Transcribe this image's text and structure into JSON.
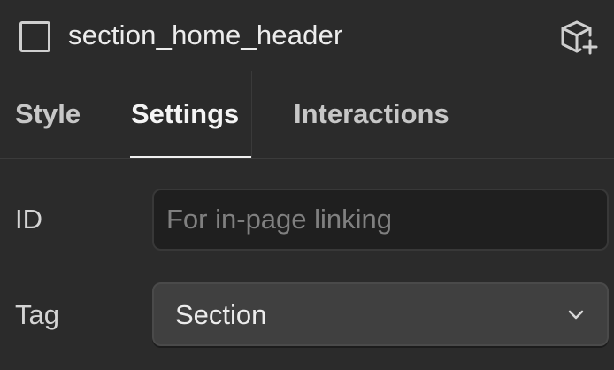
{
  "header": {
    "element_name": "section_home_header",
    "element_icon": "square-outline-icon",
    "component_icon": "cube-plus-icon"
  },
  "tabs": [
    {
      "label": "Style",
      "active": false
    },
    {
      "label": "Settings",
      "active": true
    },
    {
      "label": "Interactions",
      "active": false
    }
  ],
  "settings": {
    "id_label": "ID",
    "id_value": "",
    "id_placeholder": "For in-page linking",
    "tag_label": "Tag",
    "tag_value": "Section",
    "tag_icon": "chevron-down-icon"
  },
  "colors": {
    "background": "#2b2b2b",
    "input_background": "#1f1f1f",
    "select_background": "#404040",
    "active_tab": "#f4f4f4",
    "inactive_tab": "#c7c7c7"
  }
}
